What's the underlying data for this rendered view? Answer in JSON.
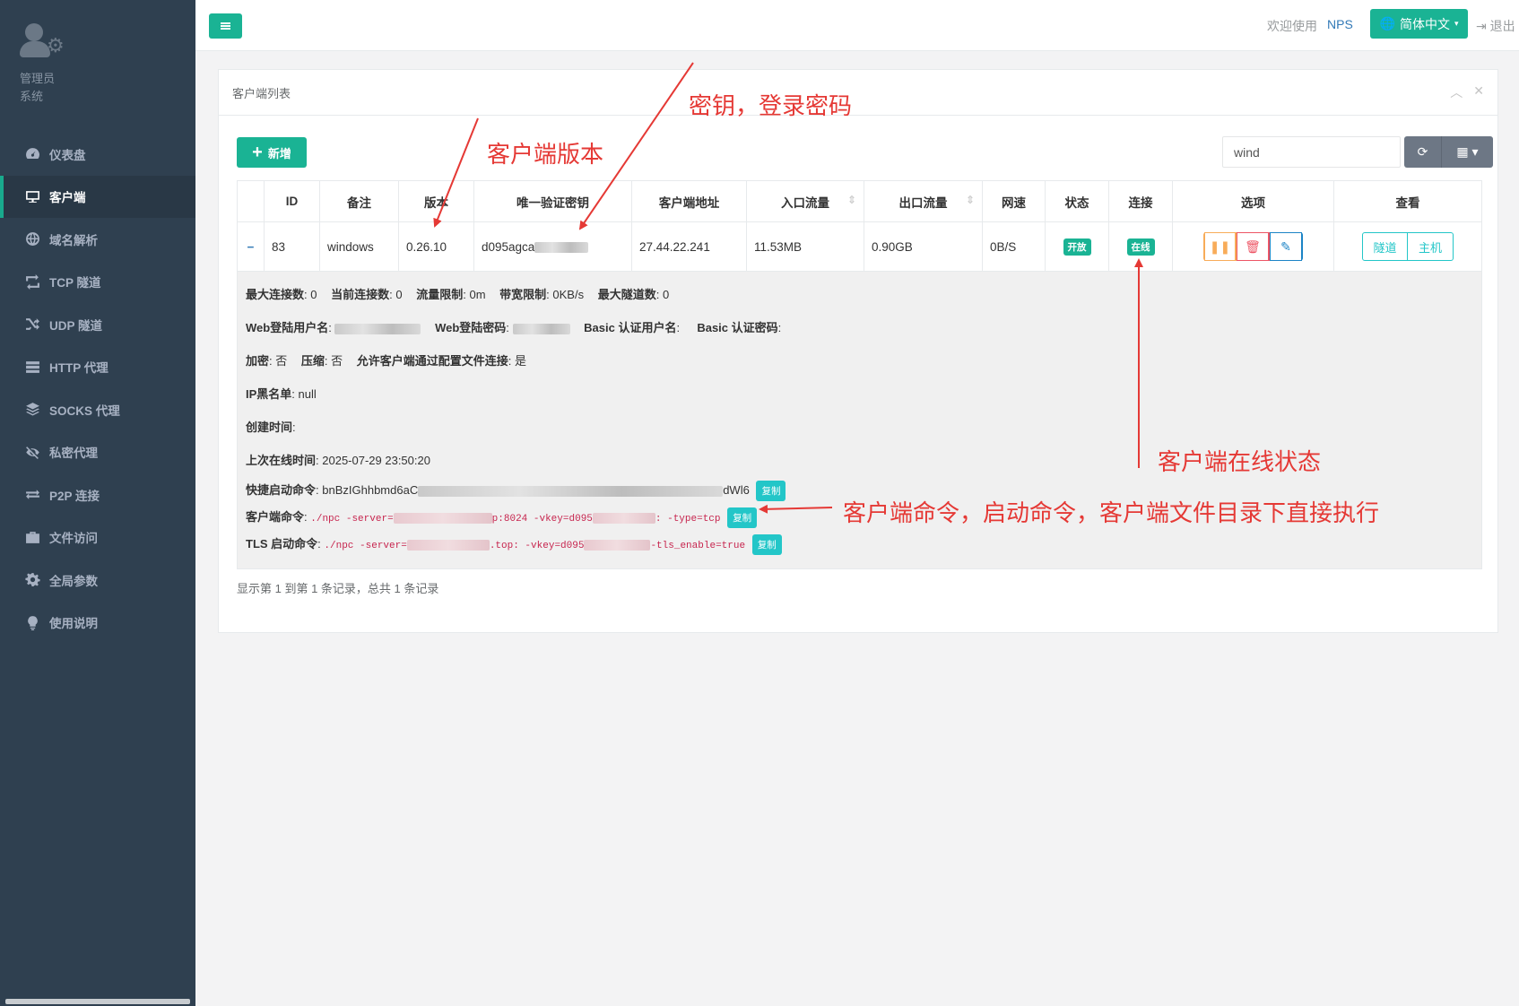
{
  "sidebar": {
    "profile": {
      "role": "管理员",
      "sub": "系统"
    },
    "items": [
      {
        "label": "仪表盘",
        "icon": "dashboard-icon"
      },
      {
        "label": "客户端",
        "icon": "desktop-icon",
        "active": true
      },
      {
        "label": "域名解析",
        "icon": "globe-icon"
      },
      {
        "label": "TCP 隧道",
        "icon": "retweet-icon"
      },
      {
        "label": "UDP 隧道",
        "icon": "random-icon"
      },
      {
        "label": "HTTP 代理",
        "icon": "server-icon"
      },
      {
        "label": "SOCKS 代理",
        "icon": "layers-icon"
      },
      {
        "label": "私密代理",
        "icon": "eye-slash-icon"
      },
      {
        "label": "P2P 连接",
        "icon": "exchange-icon"
      },
      {
        "label": "文件访问",
        "icon": "briefcase-icon"
      },
      {
        "label": "全局参数",
        "icon": "gear-icon"
      },
      {
        "label": "使用说明",
        "icon": "lightbulb-icon"
      }
    ]
  },
  "topbar": {
    "welcome": "欢迎使用",
    "brand": "NPS",
    "language": "简体中文",
    "logout": "退出"
  },
  "panel": {
    "title": "客户端列表",
    "add_label": "新增",
    "search_value": "wind"
  },
  "table": {
    "headers": [
      "ID",
      "备注",
      "版本",
      "唯一验证密钥",
      "客户端地址",
      "入口流量",
      "出口流量",
      "网速",
      "状态",
      "连接",
      "选项",
      "查看"
    ],
    "row": {
      "id": "83",
      "remark": "windows",
      "version": "0.26.10",
      "vkey": "d095agca",
      "address": "27.44.22.241",
      "inflow": "11.53MB",
      "outflow": "0.90GB",
      "speed": "0B/S",
      "status": "开放",
      "connection": "在线",
      "view_tunnel": "隧道",
      "view_host": "主机"
    }
  },
  "detail": {
    "max_conn_label": "最大连接数",
    "max_conn": "0",
    "cur_conn_label": "当前连接数",
    "cur_conn": "0",
    "flow_limit_label": "流量限制",
    "flow_limit": "0m",
    "rate_limit_label": "带宽限制",
    "rate_limit": "0KB/s",
    "max_tunnel_label": "最大隧道数",
    "max_tunnel": "0",
    "web_user_label": "Web登陆用户名",
    "web_pass_label": "Web登陆密码",
    "basic_user_label": "Basic 认证用户名",
    "basic_pass_label": "Basic 认证密码",
    "encrypt_label": "加密",
    "encrypt": "否",
    "compress_label": "压缩",
    "compress": "否",
    "allow_config_label": "允许客户端通过配置文件连接",
    "allow_config": "是",
    "ip_black_label": "IP黑名单",
    "ip_black": "null",
    "created_label": "创建时间",
    "last_online_label": "上次在线时间",
    "last_online": "2025-07-29 23:50:20",
    "quick_cmd_label": "快捷启动命令",
    "quick_cmd_start": "bnBzIGhhbmd6aC",
    "quick_cmd_end": "dWl6",
    "client_cmd_label": "客户端命令",
    "client_cmd_a": "./npc -server=",
    "client_cmd_b": "p:8024 -vkey=d095",
    "client_cmd_c": ": -type=tcp",
    "tls_cmd_label": "TLS 启动命令",
    "tls_cmd_a": "./npc -server=",
    "tls_cmd_b": ".top: -vkey=d095",
    "tls_cmd_c": "-tls_enable=true",
    "copy_label": "复制"
  },
  "pager": "显示第 1 到第 1 条记录，总共 1 条记录",
  "annotations": {
    "version": "客户端版本",
    "key": "密钥，登录密码",
    "online": "客户端在线状态",
    "command": "客户端命令，启动命令，客户端文件目录下直接执行"
  },
  "colors": {
    "accent": "#1ab394",
    "sidebar": "#2f4050",
    "annotation": "#e53935"
  }
}
